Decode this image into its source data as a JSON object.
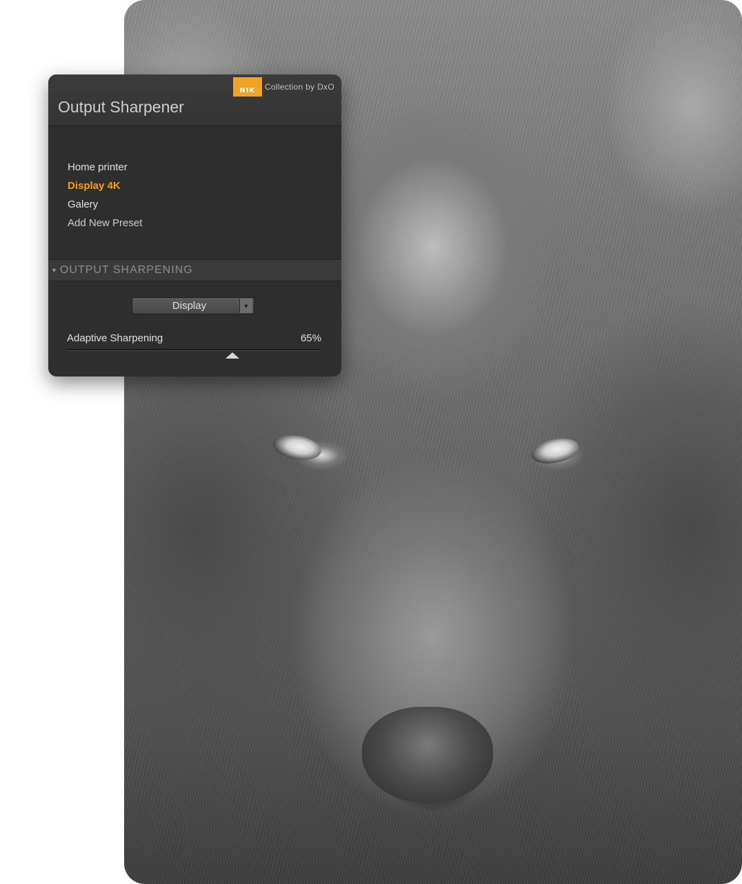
{
  "background": {
    "subject_icon": "wolf-photo"
  },
  "panel": {
    "title": "Output Sharpener",
    "brand_logo_text": "NIK",
    "brand_text": "Collection by DxO",
    "brand_color": "#f0a32a",
    "accent_color": "#f3a021"
  },
  "presets": {
    "items": [
      {
        "label": "Home printer",
        "active": false
      },
      {
        "label": "Display 4K",
        "active": true
      },
      {
        "label": "Galery",
        "active": false
      }
    ],
    "add_label": "Add New Preset"
  },
  "section": {
    "title": "OUTPUT SHARPENING",
    "caret_icon": "triangle-down-icon"
  },
  "output_type": {
    "selected": "Display",
    "arrow_icon": "dropdown-arrow-icon"
  },
  "adaptive_sharpening": {
    "label": "Adaptive Sharpening",
    "value_text": "65%",
    "value_percent": 65
  }
}
